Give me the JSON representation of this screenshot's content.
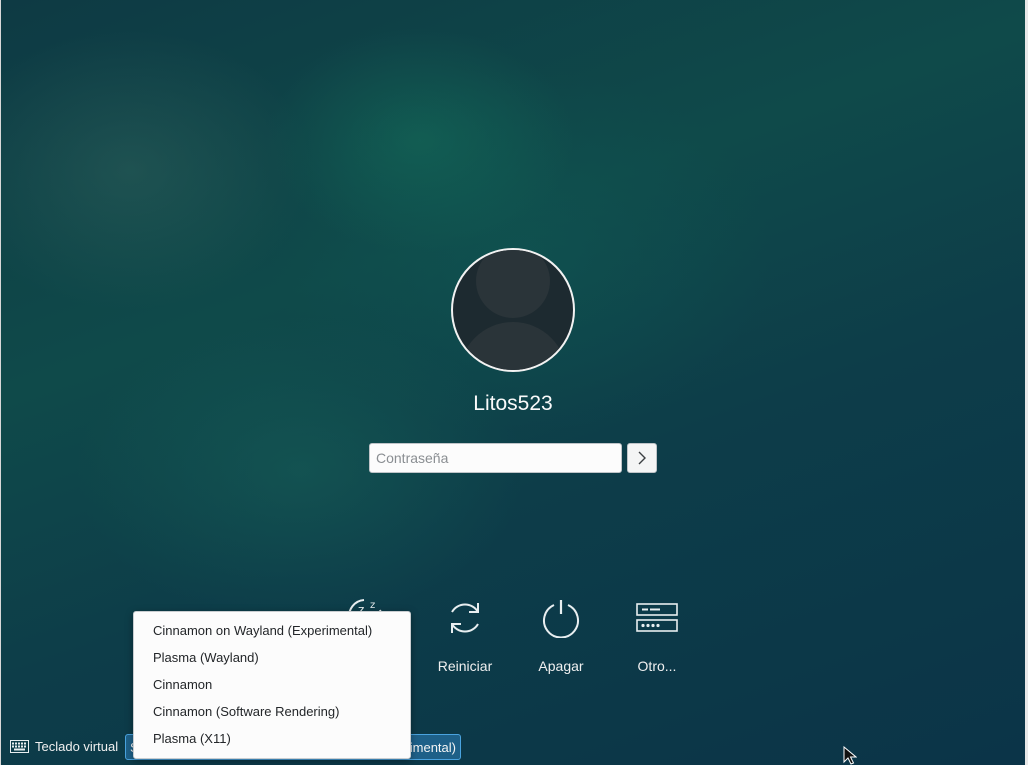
{
  "user": {
    "name": "Litos523"
  },
  "password": {
    "placeholder": "Contraseña"
  },
  "actions": [
    {
      "label": "",
      "icon": "sleep-icon"
    },
    {
      "label": "Reiniciar",
      "icon": "restart-icon"
    },
    {
      "label": "Apagar",
      "icon": "shutdown-icon"
    },
    {
      "label": "Otro...",
      "icon": "other-user-icon"
    }
  ],
  "bottom_bar": {
    "virtual_keyboard_label": "Teclado virtual",
    "session_combo_left": "S",
    "session_combo_right": "rimental)"
  },
  "session_menu": {
    "items": [
      "Cinnamon on Wayland (Experimental)",
      "Plasma (Wayland)",
      "Cinnamon",
      "Cinnamon (Software Rendering)",
      "Plasma (X11)"
    ]
  },
  "colors": {
    "background": "#0f4448",
    "menu_bg": "#fcfcfc",
    "accent": "#4aa3df"
  }
}
